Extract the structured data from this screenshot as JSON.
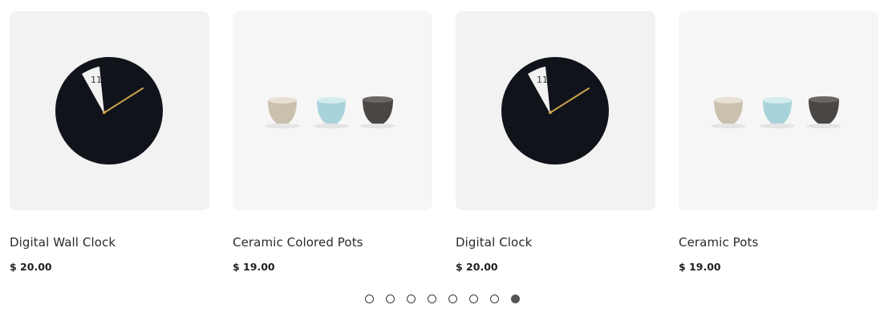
{
  "products": [
    {
      "name": "Digital Wall Clock",
      "price": "$ 20.00",
      "image": "wall-clock",
      "clock_number": "11"
    },
    {
      "name": "Ceramic Colored Pots",
      "price": "$ 19.00",
      "image": "ceramic-pots"
    },
    {
      "name": "Digital Clock",
      "price": "$ 20.00",
      "image": "wall-clock",
      "clock_number": "11"
    },
    {
      "name": "Ceramic Pots",
      "price": "$ 19.00",
      "image": "ceramic-pots"
    }
  ],
  "pagination": {
    "total": 8,
    "active_index": 7
  },
  "colors": {
    "clock_face": "#11131b",
    "clock_hand": "#c9a24a",
    "pot_beige": "#cbbfae",
    "pot_teal": "#a9d3da",
    "pot_dark": "#4a4644"
  }
}
